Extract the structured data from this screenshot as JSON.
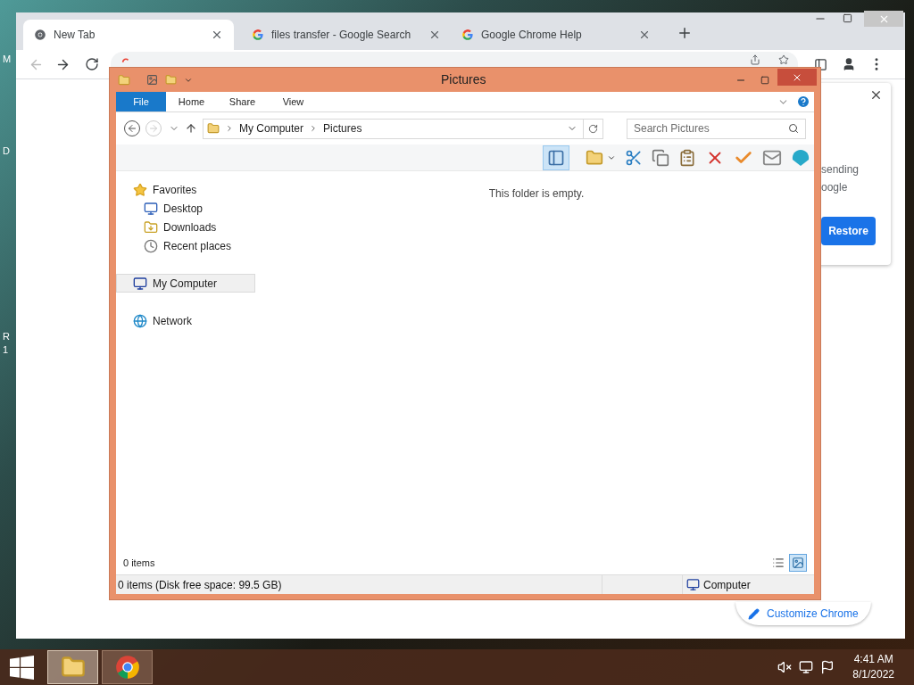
{
  "desktop": {
    "icon_labels": [
      "M",
      "D",
      "R",
      "1"
    ]
  },
  "browser": {
    "tabs": [
      {
        "title": "New Tab",
        "selected": true
      },
      {
        "title": "files transfer - Google Search",
        "selected": false
      },
      {
        "title": "Google Chrome Help",
        "selected": false
      }
    ],
    "dialog": {
      "lines": [
        "sending",
        "oogle"
      ],
      "button": "Restore"
    },
    "customize_button": "Customize Chrome"
  },
  "explorer": {
    "title": "Pictures",
    "ribbon_tabs": [
      {
        "label": "File",
        "selected": true
      },
      {
        "label": "Home",
        "selected": false
      },
      {
        "label": "Share",
        "selected": false
      },
      {
        "label": "View",
        "selected": false
      }
    ],
    "address": {
      "path": [
        "My Computer",
        "Pictures"
      ]
    },
    "search": {
      "placeholder": "Search Pictures"
    },
    "nav": [
      {
        "label": "Favorites",
        "kind": "favorites",
        "selected": false,
        "children": [
          {
            "label": "Desktop",
            "kind": "desktop",
            "selected": false
          },
          {
            "label": "Downloads",
            "kind": "downloads",
            "selected": false
          },
          {
            "label": "Recent places",
            "kind": "recent",
            "selected": false
          }
        ]
      },
      {
        "label": "My Computer",
        "kind": "computer",
        "selected": true
      },
      {
        "label": "Network",
        "kind": "network",
        "selected": false
      }
    ],
    "empty_message": "This folder is empty.",
    "item_count": "0 items",
    "views": [
      {
        "kind": "details",
        "selected": false
      },
      {
        "kind": "tiles",
        "selected": true
      }
    ],
    "status": {
      "text": "0 items (Disk free space: 99.5 GB)",
      "location": "Computer"
    }
  },
  "taskbar": {
    "time": "4:41 AM",
    "date": "8/1/2022"
  }
}
